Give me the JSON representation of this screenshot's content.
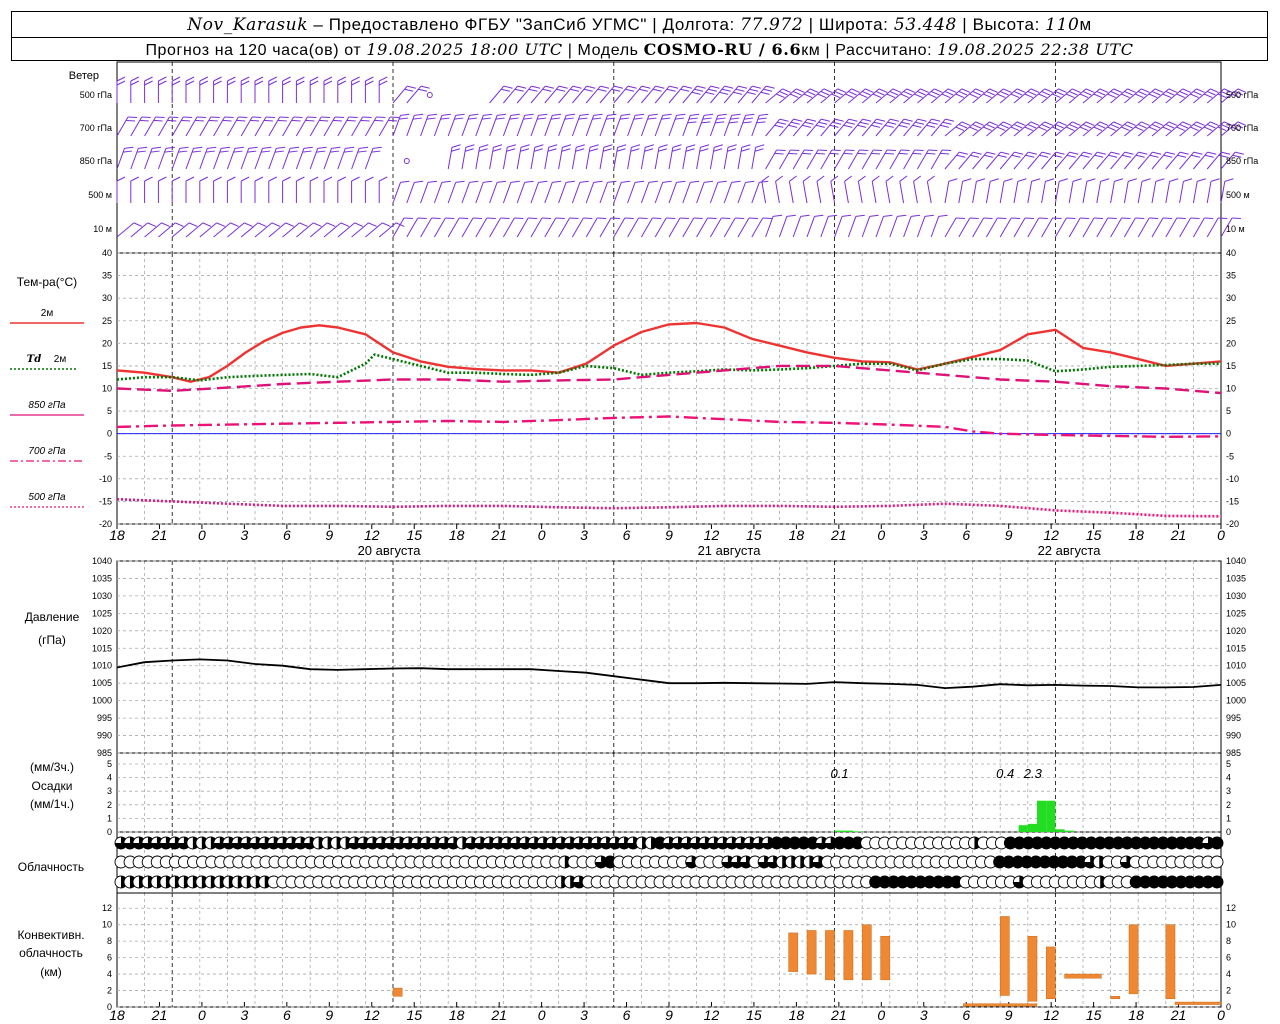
{
  "header": {
    "station": "Nov_Karasuk",
    "sep1": " – Предоставлено ФГБУ \"ЗапСиб УГМС\" | Долгота: ",
    "lon": "77.972",
    "sep2": " | Широта: ",
    "lat": "53.448",
    "sep3": " | Высота: ",
    "alt": "110",
    "alt_unit": "м",
    "fc_prefix": "Прогноз на 120 часа(ов) от ",
    "fc_start": "19.08.2025 18:00 UTC",
    "model_prefix": " | Модель ",
    "model": "COSMO-RU / 6.6",
    "model_unit": "км",
    "calc_prefix": " | Рассчитано: ",
    "calc": "19.08.2025 22:38 UTC"
  },
  "labels": {
    "wind": "Ветер",
    "wind_levels": [
      "500 гПа",
      "700 гПа",
      "850 гПа",
      "500 м",
      "10 м"
    ],
    "temp": "Тем-ра(°C)",
    "t2m": "2м",
    "td": "Td",
    "td2m": "2м",
    "t850": "850 гПа",
    "t700": "700 гПа",
    "t500": "500 гПа",
    "pressure": "Давление",
    "pressure_unit": "(гПа)",
    "precip_u3": "(мм/3ч.)",
    "precip": "Осадки",
    "precip_u1": "(мм/1ч.)",
    "cloud": "Облачность",
    "conv1": "Конвективн.",
    "conv2": "облачность",
    "conv3": "(км)"
  },
  "colors": {
    "wind": "#7b2fd6",
    "t2m": "#ee3333",
    "td": "#007700",
    "t850": "#dd1177",
    "t700": "#ee1177",
    "t500": "#ee1177",
    "zero": "#0000ff",
    "pressure": "#000000",
    "precip": "#22dd22",
    "conv": "#ee8833"
  },
  "chart_data": [
    {
      "type": "line",
      "panel": "temperature",
      "x_unit": "hours from 19.08.2025 18:00 UTC",
      "ylim": [
        -20,
        40
      ],
      "series": [
        {
          "name": "2м",
          "style": "solid",
          "x": [
            0,
            3,
            6,
            8,
            10,
            12,
            14,
            16,
            18,
            20,
            22,
            24,
            27,
            30,
            33,
            36,
            39,
            42,
            45,
            48,
            51,
            54,
            57,
            60,
            63,
            66,
            69,
            72,
            75,
            78,
            81,
            84,
            87,
            90,
            93,
            96,
            99,
            102,
            105,
            108,
            111,
            114,
            117,
            120
          ],
          "values": [
            14,
            13.5,
            12.5,
            11.5,
            12.5,
            15,
            18,
            20.5,
            22.3,
            23.5,
            24,
            23.5,
            22,
            18,
            16,
            14.8,
            14.3,
            14,
            14,
            13.5,
            15.5,
            19.5,
            22.5,
            24.2,
            24.5,
            23.5,
            21,
            19.5,
            18,
            16.8,
            16,
            15.8,
            14.2,
            15.5,
            17,
            18.5,
            22,
            23,
            19,
            18,
            16.5,
            15,
            15.5,
            16
          ]
        },
        {
          "name": "Td 2м",
          "style": "dotted",
          "x": [
            0,
            3,
            6,
            9,
            12,
            15,
            18,
            21,
            24,
            27,
            28,
            30,
            33,
            36,
            39,
            42,
            45,
            48,
            51,
            54,
            57,
            60,
            63,
            66,
            69,
            72,
            75,
            78,
            81,
            84,
            87,
            90,
            93,
            96,
            99,
            102,
            105,
            108,
            111,
            114,
            117,
            120
          ],
          "values": [
            12,
            12.5,
            12.5,
            11.8,
            12.5,
            12.8,
            13,
            13.2,
            12.5,
            15.5,
            17.5,
            16.5,
            15,
            13.5,
            13.5,
            13.2,
            13,
            13.5,
            15,
            14.5,
            13,
            13.5,
            13.8,
            14.2,
            14,
            14.2,
            14.5,
            15,
            15.5,
            15.5,
            14,
            15.5,
            16.5,
            16.5,
            16.2,
            13.8,
            14.2,
            14.8,
            15,
            15.2,
            15.5,
            15.5
          ]
        },
        {
          "name": "850 гПа",
          "style": "dashed",
          "x": [
            0,
            6,
            12,
            18,
            24,
            30,
            36,
            42,
            48,
            54,
            60,
            66,
            72,
            78,
            84,
            90,
            96,
            102,
            108,
            114,
            120
          ],
          "values": [
            10,
            9.5,
            10.2,
            11,
            11.5,
            12,
            12,
            11.5,
            11.8,
            12,
            13,
            14,
            15,
            15,
            14,
            13,
            12,
            11.5,
            10.5,
            10,
            9
          ]
        },
        {
          "name": "700 гПа",
          "style": "dashdot",
          "x": [
            0,
            6,
            12,
            18,
            24,
            30,
            36,
            42,
            48,
            54,
            60,
            66,
            72,
            78,
            84,
            90,
            93,
            96,
            102,
            108,
            114,
            120
          ],
          "values": [
            1.5,
            1.8,
            2,
            2.2,
            2.4,
            2.6,
            2.8,
            2.6,
            3,
            3.5,
            3.8,
            3.2,
            2.6,
            2.4,
            2,
            1.5,
            0.5,
            0,
            -0.3,
            -0.5,
            -0.7,
            -0.6
          ]
        },
        {
          "name": "500 гПа",
          "style": "dotted",
          "x": [
            0,
            6,
            12,
            18,
            24,
            30,
            36,
            42,
            48,
            54,
            60,
            66,
            72,
            78,
            84,
            90,
            96,
            102,
            108,
            114,
            120
          ],
          "values": [
            -14.5,
            -15,
            -15.5,
            -16,
            -16,
            -16.2,
            -16,
            -16,
            -16.3,
            -16.5,
            -16.3,
            -16,
            -16,
            -16.2,
            -16,
            -15.5,
            -16,
            -17,
            -17.5,
            -18.2,
            -18.3
          ]
        }
      ]
    },
    {
      "type": "line",
      "panel": "pressure",
      "x_unit": "hours from 19.08.2025 18:00 UTC",
      "ylim": [
        985,
        1040
      ],
      "series": [
        {
          "x": [
            0,
            3,
            6,
            9,
            12,
            15,
            18,
            21,
            24,
            27,
            30,
            33,
            36,
            39,
            42,
            45,
            48,
            51,
            54,
            57,
            60,
            63,
            66,
            69,
            72,
            75,
            78,
            81,
            84,
            87,
            90,
            93,
            96,
            99,
            102,
            105,
            108,
            111,
            114,
            117,
            120
          ],
          "values": [
            1009.5,
            1011,
            1011.5,
            1011.8,
            1011.5,
            1010.5,
            1010,
            1009,
            1008.8,
            1009,
            1009.2,
            1009.3,
            1009,
            1009,
            1009,
            1009,
            1008.5,
            1008,
            1007,
            1006,
            1005,
            1005,
            1005.1,
            1005,
            1004.9,
            1004.8,
            1005.3,
            1005,
            1004.8,
            1004.5,
            1003.6,
            1004,
            1004.7,
            1004.4,
            1004.5,
            1004.3,
            1004.2,
            1003.8,
            1003.8,
            1003.9,
            1004.5
          ]
        }
      ]
    },
    {
      "type": "bar",
      "panel": "precipitation",
      "x_unit": "hours from 19.08.2025 18:00 UTC",
      "ylim": [
        0,
        5
      ],
      "series": [
        {
          "name": "мм/1ч",
          "x": [
            78,
            79,
            80,
            98,
            99,
            100,
            101,
            102,
            103
          ],
          "values": [
            0.1,
            0.1,
            0.05,
            0.5,
            0.6,
            2.3,
            2.3,
            0.2,
            0.1
          ]
        }
      ],
      "annotations": [
        {
          "x": 78,
          "text": "0.1"
        },
        {
          "x": 96,
          "text": "0.4"
        },
        {
          "x": 99,
          "text": "2.3"
        }
      ]
    },
    {
      "type": "table",
      "panel": "cloudiness",
      "legend": "0=clear, 0.5=half, 1=overcast; rows top/middle/bottom layers, hourly",
      "rows": [
        [
          0.75,
          0.75,
          0.75,
          0.75,
          0.75,
          0.75,
          0.75,
          0.75,
          0.5,
          0.5,
          0.5,
          0.75,
          0.75,
          0.75,
          0.75,
          0.75,
          0.75,
          0.75,
          0.75,
          0.75,
          0.75,
          0.75,
          0.5,
          0.5,
          0.5,
          0.5,
          0.75,
          0.75,
          0.75,
          0.75,
          0.75,
          0.75,
          0.75,
          0.75,
          0.75,
          0.75,
          0.75,
          0.75,
          0.5,
          0.75,
          0.75,
          0.75,
          0.75,
          0.75,
          0.75,
          0.75,
          0.75,
          0.75,
          0.75,
          0.75,
          0.75,
          0.75,
          0.75,
          0.75,
          0.75,
          0.75,
          0.75,
          0.75,
          0.5,
          0.5,
          1,
          0.75,
          0.75,
          0.75,
          0.75,
          0.75,
          0.75,
          0.75,
          0.75,
          0.75,
          0.75,
          0.75,
          0.75,
          1,
          1,
          1,
          1,
          1,
          0.75,
          0.75,
          1,
          1,
          1,
          0,
          0,
          0,
          0,
          0,
          0,
          0,
          0,
          0,
          0,
          0,
          0,
          0.5,
          0,
          0,
          0,
          1,
          1,
          1,
          1,
          1,
          1,
          1,
          1,
          1,
          1,
          1,
          1,
          1,
          1,
          1,
          1,
          1,
          1,
          1,
          1,
          1,
          1,
          0.75,
          1
        ],
        [
          0,
          0,
          0,
          0,
          0,
          0,
          0,
          0,
          0,
          0,
          0,
          0,
          0,
          0,
          0,
          0,
          0,
          0,
          0,
          0,
          0,
          0,
          0,
          0,
          0,
          0,
          0,
          0,
          0,
          0,
          0,
          0,
          0,
          0,
          0,
          0,
          0,
          0,
          0,
          0,
          0,
          0,
          0,
          0,
          0,
          0,
          0,
          0,
          0,
          0.5,
          0,
          0,
          0,
          0.75,
          1,
          0,
          0,
          0,
          0,
          0,
          0,
          0,
          0,
          0.75,
          0,
          0,
          0,
          0.75,
          0.75,
          0.75,
          0,
          0.75,
          0.75,
          0.5,
          0.5,
          0.5,
          0.5,
          0.75,
          0,
          0,
          0,
          0,
          0,
          0,
          0,
          0,
          0,
          0,
          0,
          0,
          0,
          0,
          0,
          0,
          0,
          0,
          0,
          1,
          1,
          1,
          1,
          1,
          1,
          1,
          1,
          1,
          1,
          0.75,
          0.5,
          0,
          0,
          0.75,
          0,
          0,
          0,
          0,
          0,
          0,
          0,
          0,
          0,
          0
        ],
        [
          0.5,
          0.5,
          0.5,
          0.5,
          0.5,
          0.5,
          0.5,
          0.5,
          0.5,
          0.5,
          0.5,
          0.5,
          0.5,
          0.5,
          0.5,
          0.5,
          0.5,
          0,
          0,
          0,
          0,
          0,
          0,
          0,
          0,
          0,
          0,
          0,
          0,
          0,
          0,
          0,
          0,
          0,
          0,
          0,
          0,
          0,
          0,
          0,
          0,
          0,
          0,
          0,
          0,
          0,
          0,
          0,
          0,
          0.5,
          0.5,
          0.75,
          0,
          0,
          0,
          0,
          0,
          0,
          0,
          0,
          0,
          0,
          0,
          0,
          0,
          0,
          0,
          0,
          0,
          0,
          0,
          0,
          0,
          0,
          0,
          0,
          0,
          0,
          0,
          0,
          0,
          0,
          0,
          0,
          1,
          1,
          1,
          1,
          1,
          1,
          1,
          1,
          1,
          1,
          0,
          0,
          0,
          0,
          0,
          0,
          0.75,
          0,
          0,
          0,
          0,
          0,
          0,
          0,
          0,
          0.5,
          0,
          0,
          0,
          1,
          1,
          1,
          1,
          1,
          1,
          1,
          1,
          1,
          1
        ]
      ]
    },
    {
      "type": "bar",
      "panel": "convective_cloud",
      "x_unit": "hours from 19.08.2025 18:00 UTC",
      "ylim": [
        0,
        13
      ],
      "series": [
        {
          "name": "base/top км",
          "bars": [
            {
              "x": [
                30,
                31
              ],
              "bottom": 1.3,
              "top": 2.3
            },
            {
              "x": [
                73,
                74
              ],
              "bottom": 4.3,
              "top": 9
            },
            {
              "x": [
                75,
                76
              ],
              "bottom": 4,
              "top": 9.3
            },
            {
              "x": [
                77,
                78
              ],
              "bottom": 3.3,
              "top": 9.3
            },
            {
              "x": [
                79,
                80
              ],
              "bottom": 3.3,
              "top": 9.3
            },
            {
              "x": [
                81,
                82
              ],
              "bottom": 3.3,
              "top": 10
            },
            {
              "x": [
                83,
                84
              ],
              "bottom": 3.3,
              "top": 8.6
            },
            {
              "x": [
                92,
                100
              ],
              "bottom": 0.1,
              "top": 0.4
            },
            {
              "x": [
                96,
                97
              ],
              "bottom": 1.4,
              "top": 11
            },
            {
              "x": [
                99,
                100
              ],
              "bottom": 0.7,
              "top": 8.6
            },
            {
              "x": [
                101,
                102
              ],
              "bottom": 1,
              "top": 7.3
            },
            {
              "x": [
                103,
                107
              ],
              "bottom": 3.5,
              "top": 4
            },
            {
              "x": [
                108,
                109
              ],
              "bottom": 1,
              "top": 1.3
            },
            {
              "x": [
                110,
                111
              ],
              "bottom": 1.6,
              "top": 10
            },
            {
              "x": [
                114,
                115
              ],
              "bottom": 1,
              "top": 10
            },
            {
              "x": [
                115,
                120
              ],
              "bottom": 0.3,
              "top": 0.6
            }
          ]
        }
      ]
    }
  ],
  "axis": {
    "hour_ticks": [
      "18",
      "21",
      "0",
      "3",
      "6",
      "9",
      "12",
      "15",
      "18",
      "21",
      "0",
      "3",
      "6",
      "9",
      "12",
      "15",
      "18",
      "21",
      "0",
      "3",
      "6",
      "9",
      "12",
      "15",
      "18",
      "21",
      "0"
    ],
    "dates": [
      "20 августа",
      "21 августа",
      "22 августа"
    ],
    "temp_ticks": [
      "40",
      "35",
      "30",
      "25",
      "20",
      "15",
      "10",
      "5",
      "0",
      "-5",
      "-10",
      "-15",
      "-20"
    ],
    "pres_ticks": [
      "1040",
      "1035",
      "1030",
      "1025",
      "1020",
      "1015",
      "1010",
      "1005",
      "1000",
      "995",
      "990",
      "985"
    ],
    "prec_ticks": [
      "5",
      "4",
      "3",
      "2",
      "1",
      "0"
    ],
    "conv_ticks": [
      "12",
      "10",
      "8",
      "6",
      "4",
      "2",
      "0"
    ]
  }
}
